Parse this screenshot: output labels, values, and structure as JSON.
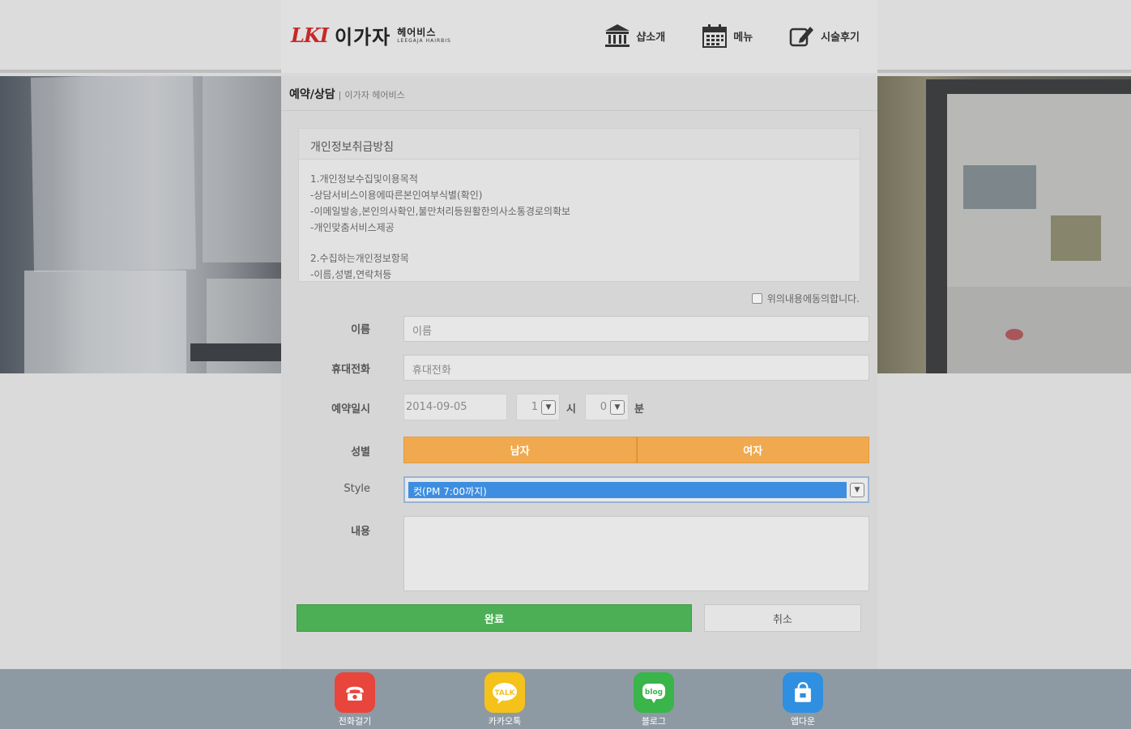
{
  "header": {
    "logo_mark": "LKI",
    "logo_name": "이가자",
    "logo_sub_kr": "헤어비스",
    "logo_sub_en": "LEEGAJA HAIRBIS",
    "nav": [
      {
        "label": "샵소개",
        "icon": "bank-icon"
      },
      {
        "label": "메뉴",
        "icon": "calendar-icon"
      },
      {
        "label": "시술후기",
        "icon": "edit-icon"
      }
    ]
  },
  "breadcrumb": {
    "title": "예약/상담",
    "separator": "|",
    "subtitle": "이가자 헤어비스"
  },
  "policy": {
    "title": "개인정보취급방침",
    "lines": [
      "1.개인정보수집및이용목적",
      "-상담서비스이용에따른본인여부식별(확인)",
      "-이메일발송,본인의사확인,불만처리등원활한의사소통경로의확보",
      "-개인맞춤서비스제공",
      "2.수집하는개인정보항목",
      "-이름,성별,연락처등"
    ]
  },
  "agree_label": "위의내용에동의합니다.",
  "form": {
    "name_label": "이름",
    "name_placeholder": "이름",
    "phone_label": "휴대전화",
    "phone_placeholder": "휴대전화",
    "datetime_label": "예약일시",
    "date_value": "2014-09-05",
    "hour_value": "1",
    "hour_unit": "시",
    "minute_value": "0",
    "minute_unit": "분",
    "gender_label": "성별",
    "gender_options": [
      "남자",
      "여자"
    ],
    "style_label": "Style",
    "style_value": "컷(PM 7:00까지)",
    "content_label": "내용",
    "submit_label": "완료",
    "cancel_label": "취소"
  },
  "footer": [
    {
      "label": "전화걸기",
      "icon": "phone-icon",
      "color": "#e8453c"
    },
    {
      "label": "카카오톡",
      "icon": "kakaotalk-icon",
      "color": "#f5c21b"
    },
    {
      "label": "블로그",
      "icon": "blog-icon",
      "color": "#39b54a"
    },
    {
      "label": "앱다운",
      "icon": "shopping-bag-icon",
      "color": "#2f8fe0"
    }
  ],
  "colors": {
    "accent_orange": "#f0a94e",
    "submit_green": "#4caf55",
    "select_blue": "#3d8ee0"
  }
}
